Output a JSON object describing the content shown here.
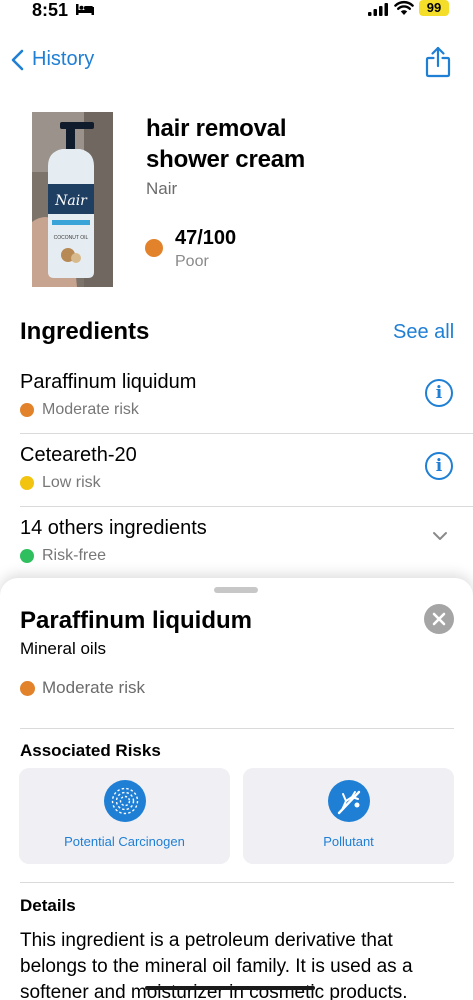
{
  "status_bar": {
    "time": "8:51",
    "battery": "99"
  },
  "nav": {
    "back_label": "History"
  },
  "product": {
    "name_line1": "hair removal",
    "name_line2": "shower cream",
    "brand": "Nair",
    "package_brand": "Nair",
    "package_label": "COCONUT OIL",
    "score": "47/100",
    "score_label": "Poor",
    "score_color": "#e2822b"
  },
  "ingredients": {
    "heading": "Ingredients",
    "see_all": "See all",
    "items": [
      {
        "name": "Paraffinum liquidum",
        "risk": "Moderate risk",
        "color": "#e2822b"
      },
      {
        "name": "Ceteareth-20",
        "risk": "Low risk",
        "color": "#f2c40f"
      },
      {
        "name": "14 others ingredients",
        "risk": "Risk-free",
        "color": "#2fbf5f"
      }
    ]
  },
  "sheet": {
    "title": "Paraffinum liquidum",
    "subtitle": "Mineral oils",
    "risk": "Moderate risk",
    "associated_heading": "Associated Risks",
    "risks": [
      {
        "label": "Potential Carcinogen",
        "icon": "carcinogen-icon"
      },
      {
        "label": "Pollutant",
        "icon": "pollutant-icon"
      }
    ],
    "details_heading": "Details",
    "details_line1": "This ingredient is a petroleum derivative that",
    "details_line2": "belongs to the mineral oil family. It is used as a",
    "details_line3": "softener and moisturizer in cosmetic products."
  },
  "colors": {
    "accent": "#1f7fd4",
    "moderate": "#e2822b",
    "low": "#f2c40f",
    "free": "#2fbf5f"
  }
}
